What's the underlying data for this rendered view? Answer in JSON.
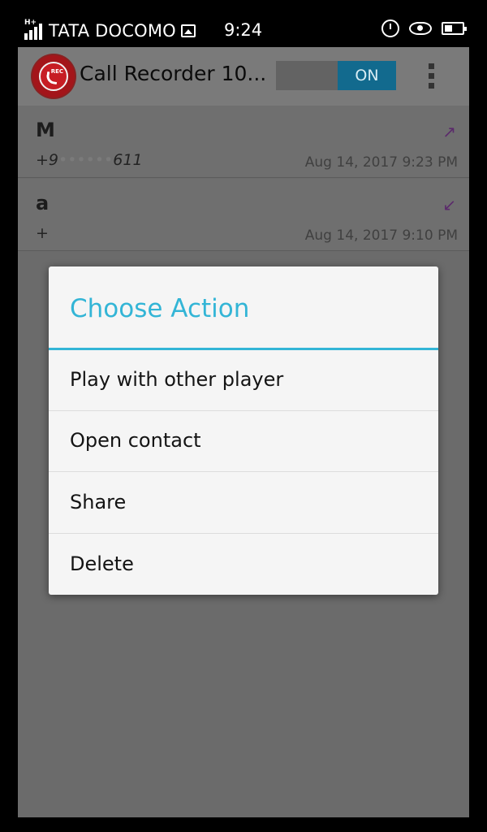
{
  "status_bar": {
    "carrier": "TATA DOCOMO",
    "time": "9:24",
    "icons": [
      "signal-icon",
      "gallery-icon",
      "alarm-icon",
      "eye-icon",
      "battery-icon"
    ]
  },
  "app_bar": {
    "title": "Call Recorder 10...",
    "toggle_label": "ON"
  },
  "recordings": [
    {
      "name": "M",
      "number": "+9",
      "number_suffix": "611",
      "date": "Aug 14, 2017  9:23 PM",
      "direction": "outgoing"
    },
    {
      "name": "a",
      "number": "+",
      "number_suffix": "",
      "date": "Aug 14, 2017  9:10 PM",
      "direction": "incoming"
    }
  ],
  "dialog": {
    "title": "Choose Action",
    "items": [
      {
        "label": "Play with other player"
      },
      {
        "label": "Open contact"
      },
      {
        "label": "Share"
      },
      {
        "label": "Delete"
      }
    ]
  },
  "colors": {
    "accent": "#33b5d6",
    "toggle_on": "#126a8e",
    "logo_red": "#c71d24"
  }
}
